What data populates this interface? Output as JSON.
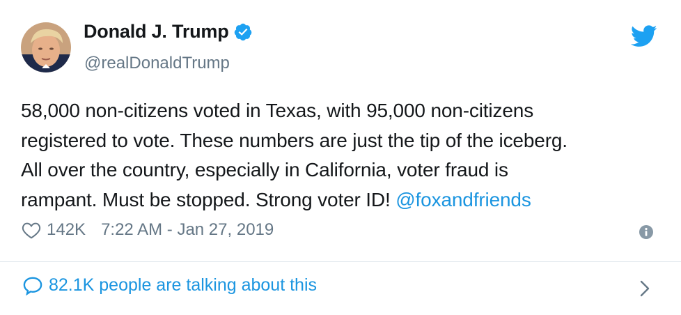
{
  "author": {
    "display_name": "Donald J. Trump",
    "handle": "@realDonaldTrump",
    "avatar_icon": "profile-photo",
    "verified_icon": "verified-badge-icon"
  },
  "tweet": {
    "text_line1": "58,000 non-citizens voted in Texas, with 95,000 non-citizens",
    "text_line2": "registered to vote. These numbers are just the tip of the iceberg.",
    "text_line3": "All over the country, especially in California, voter fraud is",
    "text_line4": "rampant. Must be stopped. Strong voter ID! ",
    "mention": "@foxandfriends"
  },
  "meta": {
    "likes": "142K",
    "timestamp": "7:22 AM - Jan 27, 2019"
  },
  "footer": {
    "talking": "82.1K people are talking about this"
  },
  "colors": {
    "link_blue": "#1b95e0",
    "twitter_blue": "#1da1f2",
    "text": "#14171a",
    "muted": "#657786",
    "divider": "#e1e8ed"
  }
}
